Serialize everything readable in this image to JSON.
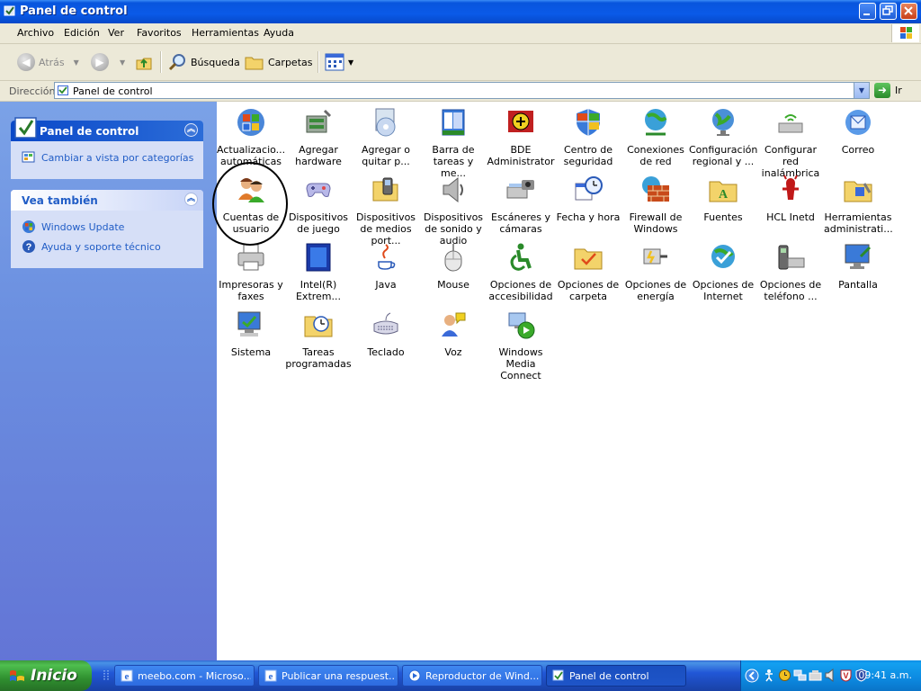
{
  "window": {
    "title": "Panel de control"
  },
  "menu": [
    "Archivo",
    "Edición",
    "Ver",
    "Favoritos",
    "Herramientas",
    "Ayuda"
  ],
  "toolbar": {
    "back": "Atrás",
    "search": "Búsqueda",
    "folders": "Carpetas"
  },
  "address": {
    "label": "Dirección",
    "value": "Panel de control",
    "go": "Ir"
  },
  "sidebar": {
    "panel1": {
      "title": "Panel de control",
      "link": "Cambiar a vista por categorías"
    },
    "panel2": {
      "title": "Vea también",
      "links": [
        "Windows Update",
        "Ayuda y soporte técnico"
      ]
    }
  },
  "items": [
    {
      "label": "Actualizacio... automáticas",
      "icon": "automatic-updates-icon"
    },
    {
      "label": "Agregar hardware",
      "icon": "add-hardware-icon"
    },
    {
      "label": "Agregar o quitar p...",
      "icon": "add-remove-programs-icon"
    },
    {
      "label": "Barra de tareas y me...",
      "icon": "taskbar-icon"
    },
    {
      "label": "BDE Administrator",
      "icon": "bde-icon"
    },
    {
      "label": "Centro de seguridad",
      "icon": "security-center-icon"
    },
    {
      "label": "Conexiones de red",
      "icon": "network-connections-icon"
    },
    {
      "label": "Configuración regional y ...",
      "icon": "regional-settings-icon"
    },
    {
      "label": "Configurar red inalámbrica",
      "icon": "wireless-network-icon"
    },
    {
      "label": "Correo",
      "icon": "mail-icon"
    },
    {
      "label": "Cuentas de usuario",
      "icon": "user-accounts-icon"
    },
    {
      "label": "Dispositivos de juego",
      "icon": "game-controllers-icon"
    },
    {
      "label": "Dispositivos de medios port...",
      "icon": "portable-media-icon"
    },
    {
      "label": "Dispositivos de sonido y audio",
      "icon": "sound-icon"
    },
    {
      "label": "Escáneres y cámaras",
      "icon": "scanners-cameras-icon"
    },
    {
      "label": "Fecha y hora",
      "icon": "date-time-icon"
    },
    {
      "label": "Firewall de Windows",
      "icon": "firewall-icon"
    },
    {
      "label": "Fuentes",
      "icon": "fonts-icon"
    },
    {
      "label": "HCL Inetd",
      "icon": "hcl-inetd-icon"
    },
    {
      "label": "Herramientas administrati...",
      "icon": "admin-tools-icon"
    },
    {
      "label": "Impresoras y faxes",
      "icon": "printers-icon"
    },
    {
      "label": "Intel(R) Extrem...",
      "icon": "intel-graphics-icon"
    },
    {
      "label": "Java",
      "icon": "java-icon"
    },
    {
      "label": "Mouse",
      "icon": "mouse-icon"
    },
    {
      "label": "Opciones de accesibilidad",
      "icon": "accessibility-icon"
    },
    {
      "label": "Opciones de carpeta",
      "icon": "folder-options-icon"
    },
    {
      "label": "Opciones de energía",
      "icon": "power-options-icon"
    },
    {
      "label": "Opciones de Internet",
      "icon": "internet-options-icon"
    },
    {
      "label": "Opciones de teléfono ...",
      "icon": "phone-modem-icon"
    },
    {
      "label": "Pantalla",
      "icon": "display-icon"
    },
    {
      "label": "Sistema",
      "icon": "system-icon"
    },
    {
      "label": "Tareas programadas",
      "icon": "scheduled-tasks-icon"
    },
    {
      "label": "Teclado",
      "icon": "keyboard-icon"
    },
    {
      "label": "Voz",
      "icon": "speech-icon"
    },
    {
      "label": "Windows Media Connect",
      "icon": "media-connect-icon"
    }
  ],
  "taskbar": {
    "start": "Inicio",
    "tasks": [
      "meebo.com - Microso...",
      "Publicar una respuest...",
      "Reproductor de Wind...",
      "Panel de control"
    ],
    "clock": "09:41 a.m."
  }
}
